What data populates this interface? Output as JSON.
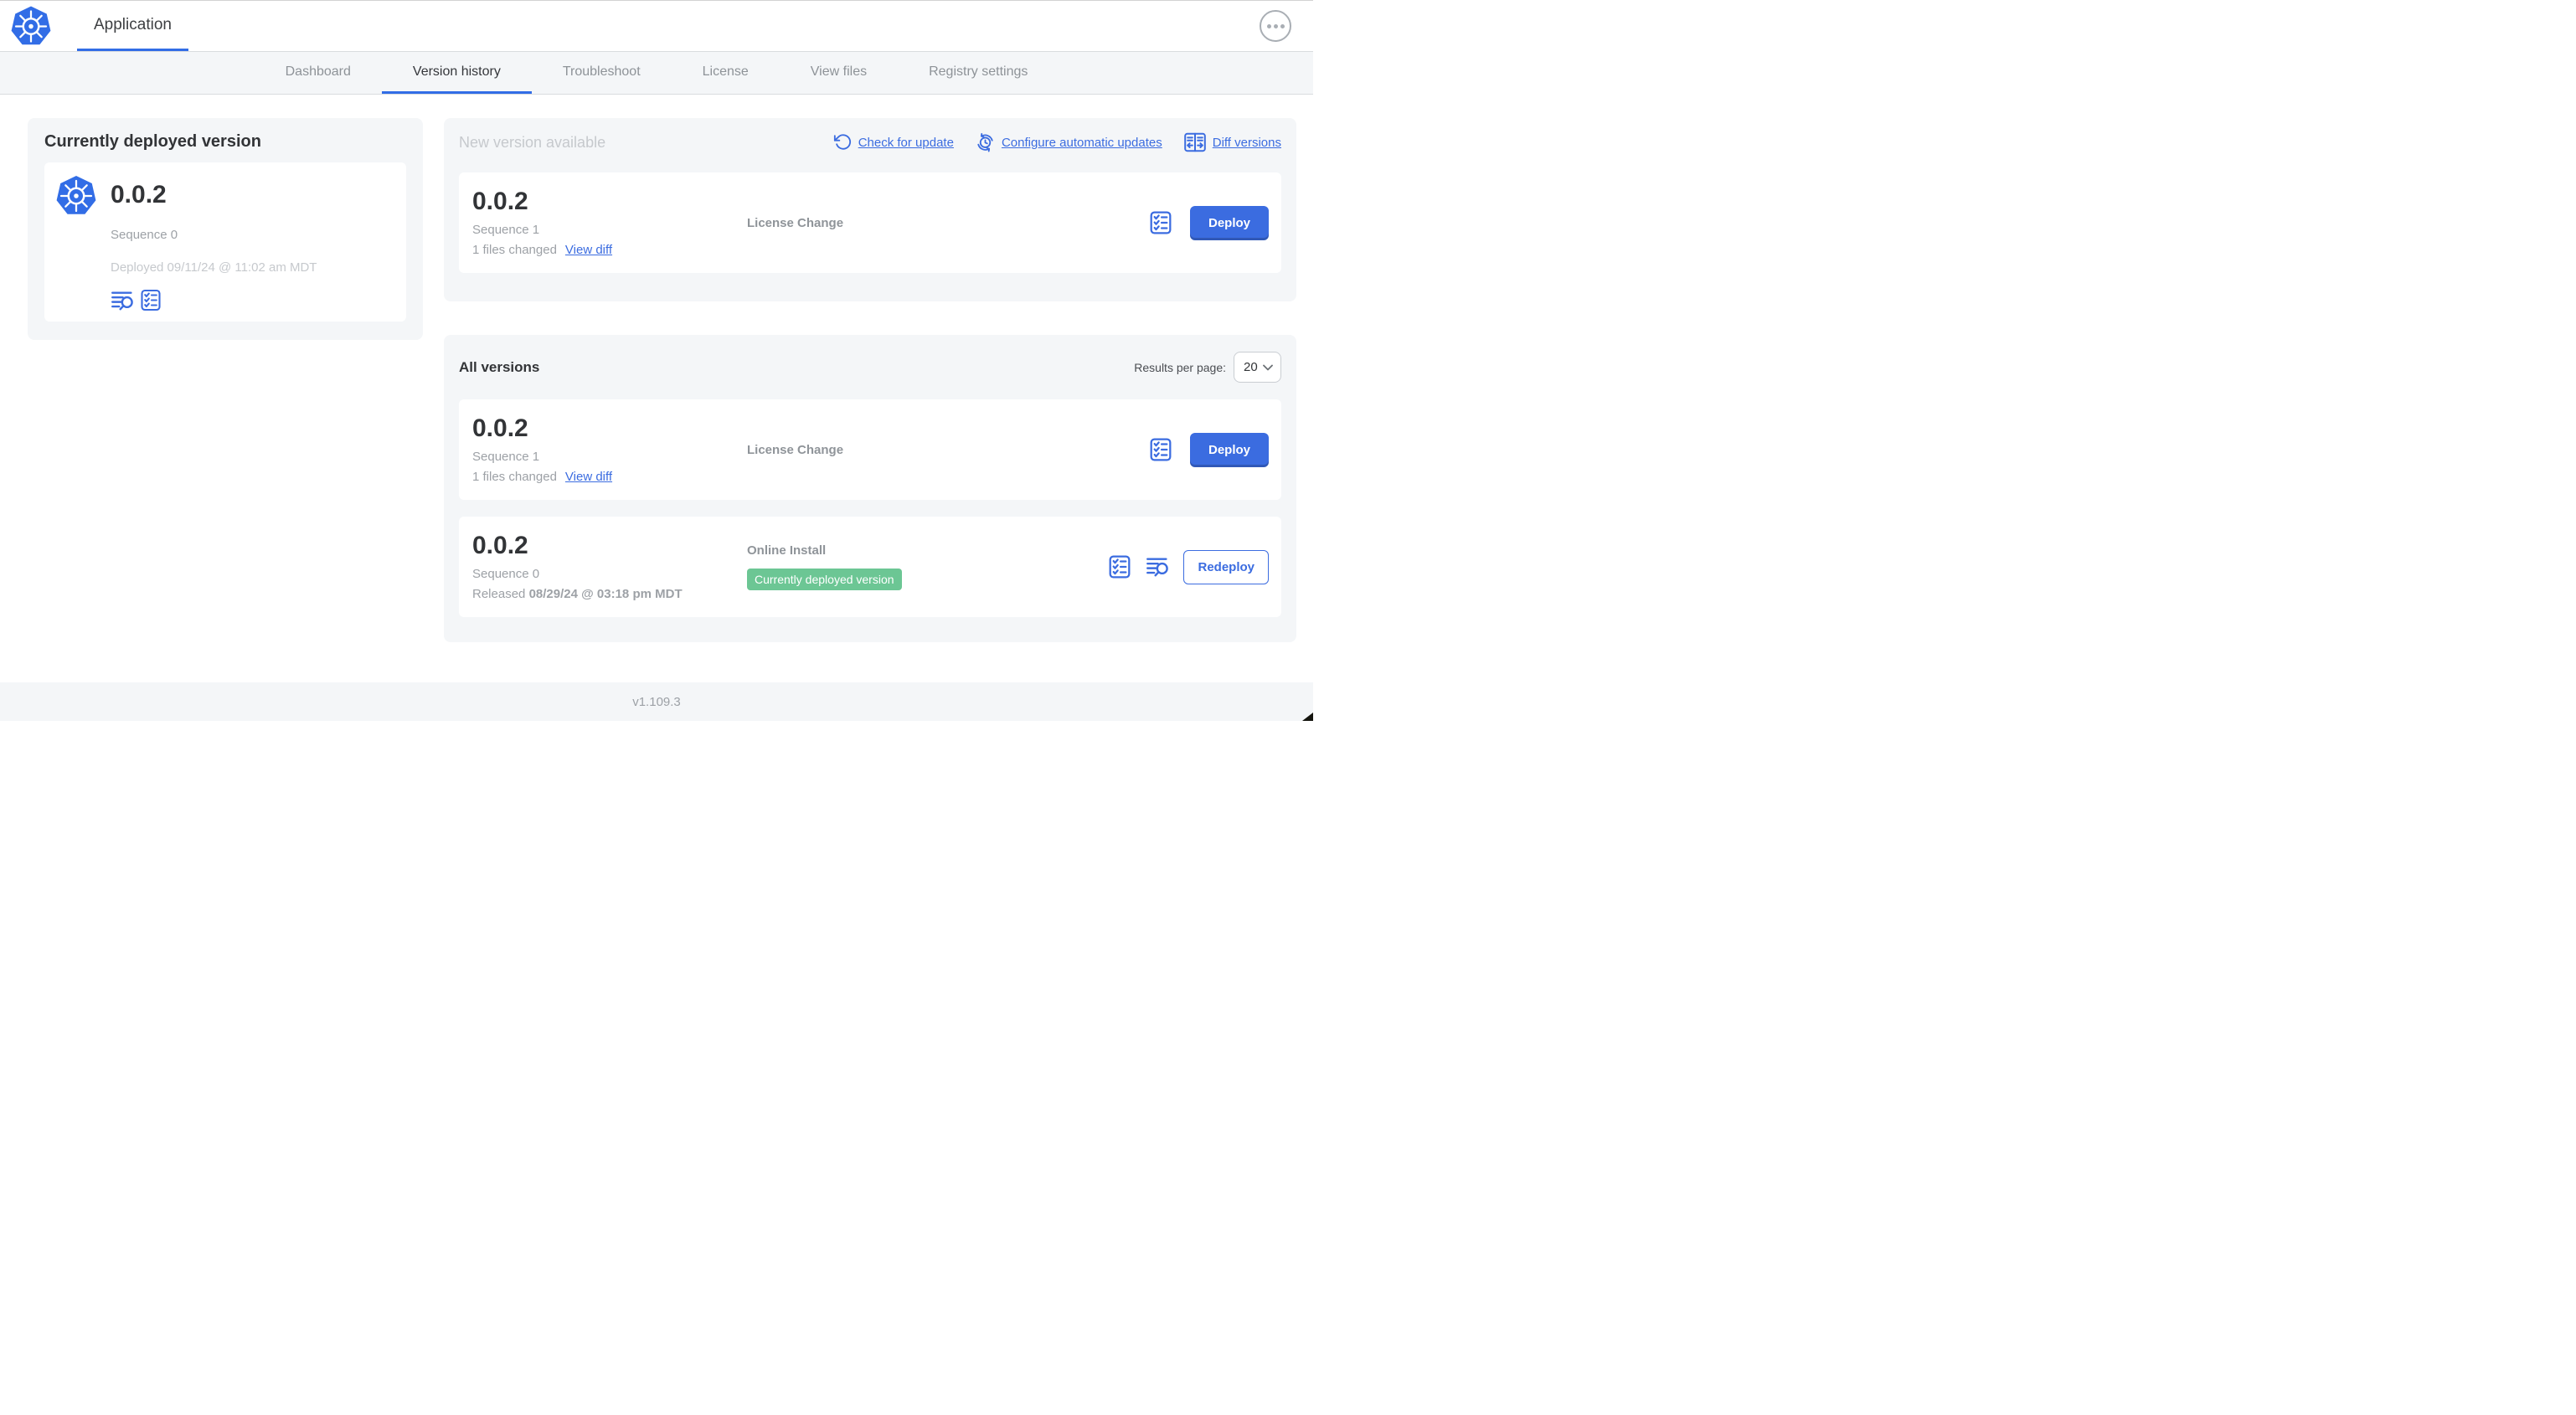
{
  "header": {
    "app_title": "Application"
  },
  "nav": {
    "tabs": [
      {
        "label": "Dashboard"
      },
      {
        "label": "Version history"
      },
      {
        "label": "Troubleshoot"
      },
      {
        "label": "License"
      },
      {
        "label": "View files"
      },
      {
        "label": "Registry settings"
      }
    ],
    "active_tab": "Version history"
  },
  "current_version": {
    "title": "Currently deployed version",
    "version": "0.0.2",
    "sequence": "Sequence 0",
    "deployed": "Deployed 09/11/24 @ 11:02 am MDT"
  },
  "new_version": {
    "title": "New version available",
    "check_link": "Check for update",
    "configure_link": "Configure automatic updates",
    "diff_link": "Diff versions",
    "card": {
      "version": "0.0.2",
      "sequence": "Sequence 1",
      "files_changed": "1 files changed",
      "view_diff_label": "View diff",
      "source": "License Change",
      "deploy_label": "Deploy"
    }
  },
  "all_versions": {
    "title": "All versions",
    "results_per_page_label": "Results per page:",
    "results_per_page_value": "20",
    "row1": {
      "version": "0.0.2",
      "sequence": "Sequence 1",
      "files_changed": "1 files changed",
      "view_diff_label": "View diff",
      "source": "License Change",
      "deploy_label": "Deploy"
    },
    "row2": {
      "version": "0.0.2",
      "sequence": "Sequence 0",
      "released_prefix": "Released",
      "released_date": "08/29/24 @ 03:18 pm MDT",
      "source": "Online Install",
      "badge": "Currently deployed version",
      "redeploy_label": "Redeploy"
    }
  },
  "footer": {
    "app_version": "v1.109.3"
  },
  "colors": {
    "primary_blue": "#3B6CE0",
    "logo_blue": "#326DE6",
    "badge_green": "#6CC694",
    "active_tab_underline": "#326DE6"
  }
}
